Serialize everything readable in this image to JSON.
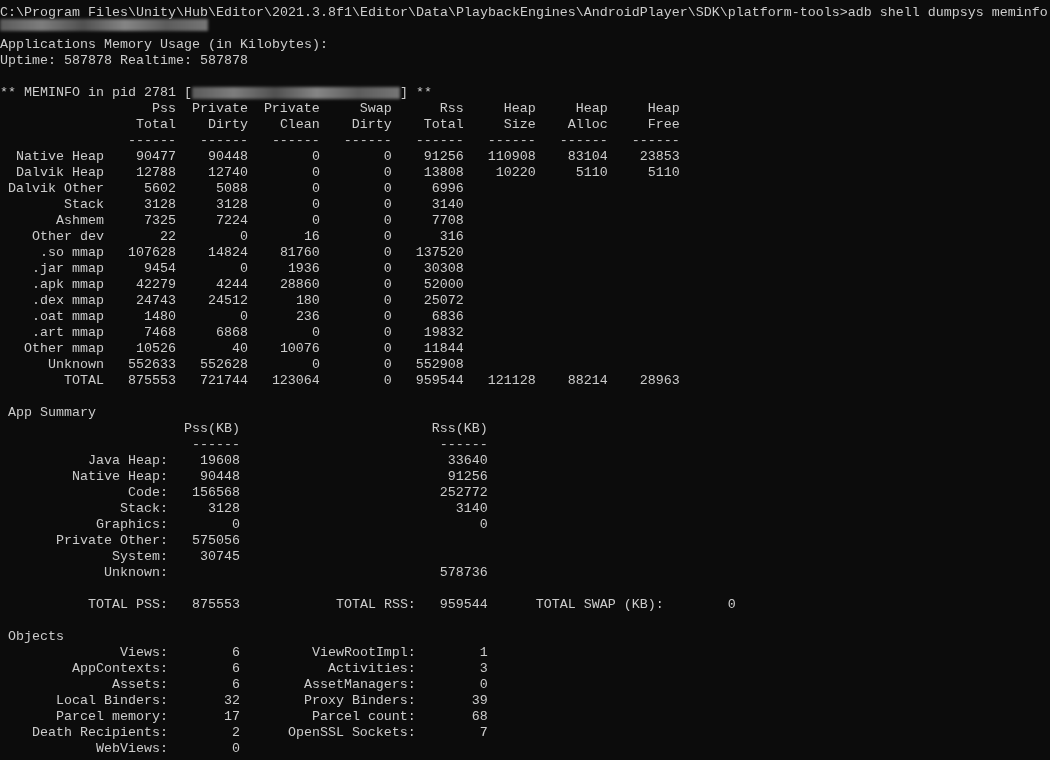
{
  "command": {
    "prompt": "C:\\Program Files\\Unity\\Hub\\Editor\\2021.3.8f1\\Editor\\Data\\PlaybackEngines\\AndroidPlayer\\SDK\\platform-tools>",
    "input": "adb shell dumpsys meminfo"
  },
  "output_lines": [
    "Applications Memory Usage (in Kilobytes):",
    "Uptime: 587878 Realtime: 587878"
  ],
  "meminfo_header": {
    "prefix": "** MEMINFO in pid 2781 [",
    "suffix": "] **"
  },
  "meminfo_table": {
    "columns": [
      {
        "top": "Pss",
        "bottom": "Total",
        "rule": "------"
      },
      {
        "top": "Private",
        "bottom": "Dirty",
        "rule": "------"
      },
      {
        "top": "Private",
        "bottom": "Clean",
        "rule": "------"
      },
      {
        "top": "Swap",
        "bottom": "Dirty",
        "rule": "------"
      },
      {
        "top": "Rss",
        "bottom": "Total",
        "rule": "------"
      },
      {
        "top": "Heap",
        "bottom": "Size",
        "rule": "------"
      },
      {
        "top": "Heap",
        "bottom": "Alloc",
        "rule": "------"
      },
      {
        "top": "Heap",
        "bottom": "Free",
        "rule": "------"
      }
    ],
    "rows": [
      {
        "label": "Native Heap",
        "values": [
          "90477",
          "90448",
          "0",
          "0",
          "91256",
          "110908",
          "83104",
          "23853"
        ]
      },
      {
        "label": "Dalvik Heap",
        "values": [
          "12788",
          "12740",
          "0",
          "0",
          "13808",
          "10220",
          "5110",
          "5110"
        ]
      },
      {
        "label": "Dalvik Other",
        "values": [
          "5602",
          "5088",
          "0",
          "0",
          "6996"
        ]
      },
      {
        "label": "Stack",
        "values": [
          "3128",
          "3128",
          "0",
          "0",
          "3140"
        ]
      },
      {
        "label": "Ashmem",
        "values": [
          "7325",
          "7224",
          "0",
          "0",
          "7708"
        ]
      },
      {
        "label": "Other dev",
        "values": [
          "22",
          "0",
          "16",
          "0",
          "316"
        ]
      },
      {
        "label": ".so mmap",
        "values": [
          "107628",
          "14824",
          "81760",
          "0",
          "137520"
        ]
      },
      {
        "label": ".jar mmap",
        "values": [
          "9454",
          "0",
          "1936",
          "0",
          "30308"
        ]
      },
      {
        "label": ".apk mmap",
        "values": [
          "42279",
          "4244",
          "28860",
          "0",
          "52000"
        ]
      },
      {
        "label": ".dex mmap",
        "values": [
          "24743",
          "24512",
          "180",
          "0",
          "25072"
        ]
      },
      {
        "label": ".oat mmap",
        "values": [
          "1480",
          "0",
          "236",
          "0",
          "6836"
        ]
      },
      {
        "label": ".art mmap",
        "values": [
          "7468",
          "6868",
          "0",
          "0",
          "19832"
        ]
      },
      {
        "label": "Other mmap",
        "values": [
          "10526",
          "40",
          "10076",
          "0",
          "11844"
        ]
      },
      {
        "label": "Unknown",
        "values": [
          "552633",
          "552628",
          "0",
          "0",
          "552908"
        ]
      },
      {
        "label": "TOTAL",
        "values": [
          "875553",
          "721744",
          "123064",
          "0",
          "959544",
          "121128",
          "88214",
          "28963"
        ]
      }
    ]
  },
  "app_summary": {
    "title": "App Summary",
    "headers": [
      {
        "label": "Pss(KB)",
        "rule": "------"
      },
      {
        "label": "Rss(KB)",
        "rule": "------"
      }
    ],
    "rows": [
      {
        "label": "Java Heap:",
        "pss": "19608",
        "rss": "33640"
      },
      {
        "label": "Native Heap:",
        "pss": "90448",
        "rss": "91256"
      },
      {
        "label": "Code:",
        "pss": "156568",
        "rss": "252772"
      },
      {
        "label": "Stack:",
        "pss": "3128",
        "rss": "3140"
      },
      {
        "label": "Graphics:",
        "pss": "0",
        "rss": "0"
      },
      {
        "label": "Private Other:",
        "pss": "575056"
      },
      {
        "label": "System:",
        "pss": "30745"
      },
      {
        "label": "Unknown:",
        "rss": "578736"
      }
    ]
  },
  "totals": [
    {
      "label": "TOTAL PSS:",
      "value": "875553"
    },
    {
      "label": "TOTAL RSS:",
      "value": "959544"
    },
    {
      "label": "TOTAL SWAP (KB):",
      "value": "0"
    }
  ],
  "objects": {
    "title": "Objects",
    "rows": [
      {
        "left": {
          "label": "Views:",
          "value": "6"
        },
        "right": {
          "label": "ViewRootImpl:",
          "value": "1"
        }
      },
      {
        "left": {
          "label": "AppContexts:",
          "value": "6"
        },
        "right": {
          "label": "Activities:",
          "value": "3"
        }
      },
      {
        "left": {
          "label": "Assets:",
          "value": "6"
        },
        "right": {
          "label": "AssetManagers:",
          "value": "0"
        }
      },
      {
        "left": {
          "label": "Local Binders:",
          "value": "32"
        },
        "right": {
          "label": "Proxy Binders:",
          "value": "39"
        }
      },
      {
        "left": {
          "label": "Parcel memory:",
          "value": "17"
        },
        "right": {
          "label": "Parcel count:",
          "value": "68"
        }
      },
      {
        "left": {
          "label": "Death Recipients:",
          "value": "2"
        },
        "right": {
          "label": "OpenSSL Sockets:",
          "value": "7"
        }
      },
      {
        "left": {
          "label": "WebViews:",
          "value": "0"
        }
      }
    ]
  }
}
